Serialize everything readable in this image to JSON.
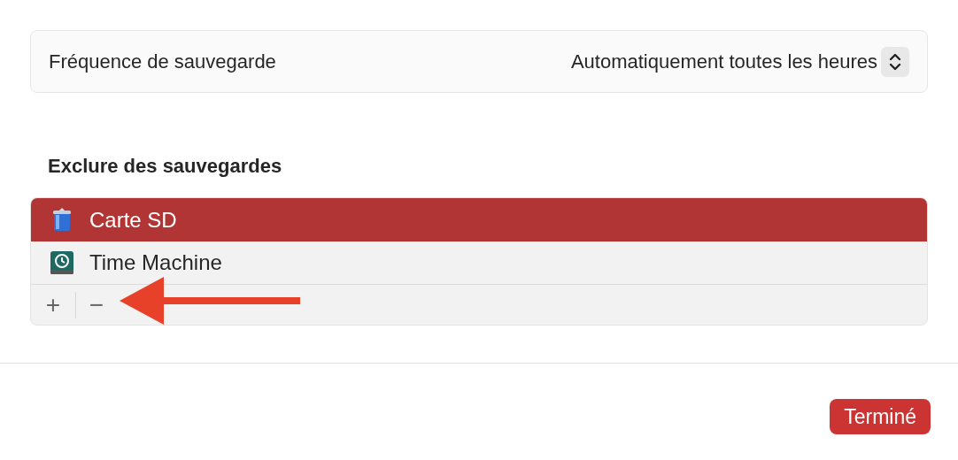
{
  "frequency": {
    "label": "Fréquence de sauvegarde",
    "value": "Automatiquement toutes les heures"
  },
  "exclusions": {
    "title": "Exclure des sauvegardes",
    "items": [
      {
        "name": "Carte SD",
        "kind": "trash",
        "selected": true
      },
      {
        "name": "Time Machine",
        "kind": "drive",
        "selected": false
      }
    ],
    "add": "+",
    "remove": "−"
  },
  "annotation": {
    "kind": "arrow"
  },
  "done_button": "Terminé"
}
